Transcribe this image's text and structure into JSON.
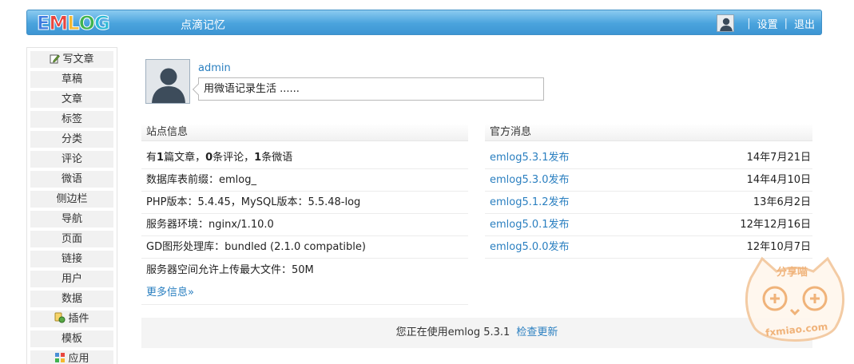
{
  "header": {
    "logo_text": "EMLOG",
    "logo_letters": [
      {
        "ch": "E",
        "color": "#3c7be0"
      },
      {
        "ch": "M",
        "color": "#e8463f"
      },
      {
        "ch": "L",
        "color": "#f5b82e"
      },
      {
        "ch": "O",
        "color": "#3fb34f"
      },
      {
        "ch": "G",
        "color": "#2bb9d6"
      }
    ],
    "site_name": "点滴记忆",
    "separator": "|",
    "settings_label": "设置",
    "logout_label": "退出"
  },
  "sidebar": {
    "items": [
      {
        "label": "写文章",
        "icon": "pencil-icon"
      },
      {
        "label": "草稿"
      },
      {
        "label": "文章"
      },
      {
        "label": "标签"
      },
      {
        "label": "分类"
      },
      {
        "label": "评论"
      },
      {
        "label": "微语"
      },
      {
        "label": "侧边栏"
      },
      {
        "label": "导航"
      },
      {
        "label": "页面"
      },
      {
        "label": "链接"
      },
      {
        "label": "用户"
      },
      {
        "label": "数据"
      },
      {
        "label": "插件",
        "icon": "plugin-icon"
      },
      {
        "label": "模板"
      },
      {
        "label": "应用",
        "icon": "app-icon"
      }
    ]
  },
  "profile": {
    "name": "admin",
    "status_text": "用微语记录生活 ......"
  },
  "site_info": {
    "heading": "站点信息",
    "stats": {
      "p1": "有",
      "posts": "1",
      "p2": "篇文章，",
      "comments": "0",
      "p3": "条评论，",
      "twitters": "1",
      "p4": "条微语"
    },
    "rows": [
      "数据库表前缀：emlog_",
      "PHP版本：5.4.45，MySQL版本：5.5.48-log",
      "服务器环境：nginx/1.10.0",
      "GD图形处理库：bundled (2.1.0 compatible)",
      "服务器空间允许上传最大文件：50M"
    ],
    "more_link": "更多信息»"
  },
  "news": {
    "heading": "官方消息",
    "items": [
      {
        "title": "emlog5.3.1发布",
        "date": "14年7月21日"
      },
      {
        "title": "emlog5.3.0发布",
        "date": "14年4月10日"
      },
      {
        "title": "emlog5.1.2发布",
        "date": "13年6月2日"
      },
      {
        "title": "emlog5.0.1发布",
        "date": "12年12月16日"
      },
      {
        "title": "emlog5.0.0发布",
        "date": "12年10月7日"
      }
    ]
  },
  "footer": {
    "version_text": "您正在使用emlog 5.3.1",
    "update_link": "检查更新"
  },
  "watermark": {
    "top_text": "分享喵",
    "bottom_text": "fxmiao.com"
  },
  "colors": {
    "header_blue": "#4aa3dd",
    "link_blue": "#2a7fc0",
    "watermark_orange": "#f0b37a"
  }
}
